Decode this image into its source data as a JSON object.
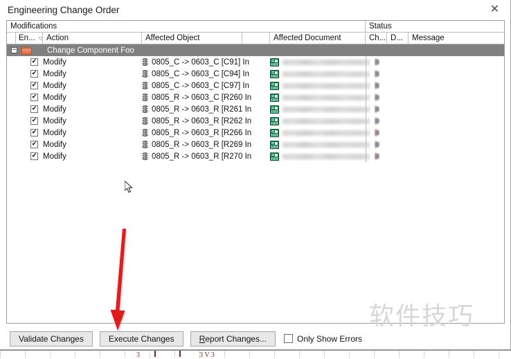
{
  "window": {
    "title": "Engineering Change Order",
    "close_label": "✕"
  },
  "grid": {
    "group_headers": [
      {
        "label": "Modifications"
      },
      {
        "label": "Status"
      }
    ],
    "columns": [
      {
        "label": "En...",
        "sort": "▽"
      },
      {
        "label": "Action"
      },
      {
        "label": "Affected Object"
      },
      {
        "label": ""
      },
      {
        "label": "Affected Document"
      },
      {
        "label": "Ch..."
      },
      {
        "label": "D..."
      },
      {
        "label": "Message"
      }
    ],
    "group_row": {
      "label": "Change Component Foo",
      "expander": "−"
    },
    "check_mark": "✔",
    "rows": [
      {
        "enabled": true,
        "action": "Modify",
        "object": "0805_C -> 0603_C [C91]  In"
      },
      {
        "enabled": true,
        "action": "Modify",
        "object": "0805_C -> 0603_C [C94]  In"
      },
      {
        "enabled": true,
        "action": "Modify",
        "object": "0805_C -> 0603_C [C97]  In"
      },
      {
        "enabled": true,
        "action": "Modify",
        "object": "0805_R -> 0603_C [R260  In"
      },
      {
        "enabled": true,
        "action": "Modify",
        "object": "0805_R -> 0603_R [R261  In"
      },
      {
        "enabled": true,
        "action": "Modify",
        "object": "0805_R -> 0603_R [R262  In"
      },
      {
        "enabled": true,
        "action": "Modify",
        "object": "0805_R -> 0603_R [R266  In"
      },
      {
        "enabled": true,
        "action": "Modify",
        "object": "0805_R -> 0603_R [R269  In"
      },
      {
        "enabled": true,
        "action": "Modify",
        "object": "0805_R -> 0603_R [R270  In"
      }
    ]
  },
  "buttons": {
    "validate": "Validate Changes",
    "execute": "Execute Changes",
    "report_prefix": "R",
    "report_rest": "eport Changes...",
    "only_show_errors": "Only Show Errors",
    "only_show_errors_checked": false
  },
  "annotation": {
    "arrow_color": "#e01b1b",
    "points_to": "Execute Changes"
  },
  "watermark": {
    "text": "软件技巧"
  },
  "colors": {
    "group_row_bg": "#808080",
    "folder_icon": "#e2643a",
    "board_icon": "#0d7a4a",
    "button_bg": "#e8e8e8"
  }
}
